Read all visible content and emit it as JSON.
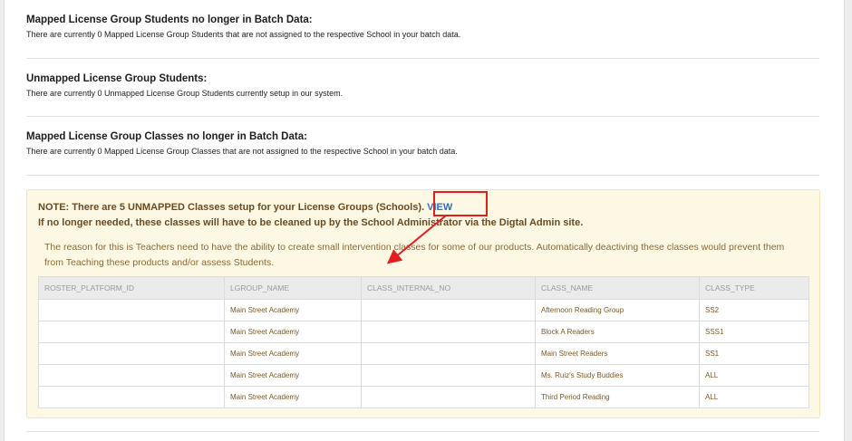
{
  "sections": [
    {
      "title": "Mapped License Group Students no longer in Batch Data:",
      "text": "There are currently 0 Mapped License Group Students that are not assigned to the respective School in your batch data."
    },
    {
      "title": "Unmapped License Group Students:",
      "text": "There are currently 0 Unmapped License Group Students currently setup in our system."
    },
    {
      "title": "Mapped License Group Classes no longer in Batch Data:",
      "text": "There are currently 0 Mapped License Group Classes that are not assigned to the respective School in your batch data."
    }
  ],
  "note": {
    "line1": "NOTE: There are 5 UNMAPPED Classes setup for your License Groups (Schools).",
    "view_label": "VIEW",
    "line2": "If no longer needed, these classes will have to be cleaned up by the School Administrator via the Digtal Admin site.",
    "reason": "The reason for this is Teachers need to have the ability to create small intervention classes for some of our products. Automatically deactiving these classes would prevent them from Teaching these products and/or assess Students."
  },
  "table": {
    "columns": [
      "ROSTER_PLATFORM_ID",
      "LGROUP_NAME",
      "CLASS_INTERNAL_NO",
      "CLASS_NAME",
      "CLASS_TYPE"
    ],
    "rows": [
      [
        "",
        "Main Street Academy",
        "",
        "Afternoon Reading Group",
        "SS2"
      ],
      [
        "",
        "Main Street Academy",
        "",
        "Block A Readers",
        "SSS1"
      ],
      [
        "",
        "Main Street Academy",
        "",
        "Main Street Readers",
        "SS1"
      ],
      [
        "",
        "Main Street Academy",
        "",
        "Ms. Ruiz's Study Buddies",
        "ALL"
      ],
      [
        "",
        "Main Street Academy",
        "",
        "Third Period Reading",
        "ALL"
      ]
    ]
  },
  "colors": {
    "annotation_red": "#e41d1d",
    "link_blue": "#2a6fcb",
    "note_background": "#fcf8e3"
  }
}
